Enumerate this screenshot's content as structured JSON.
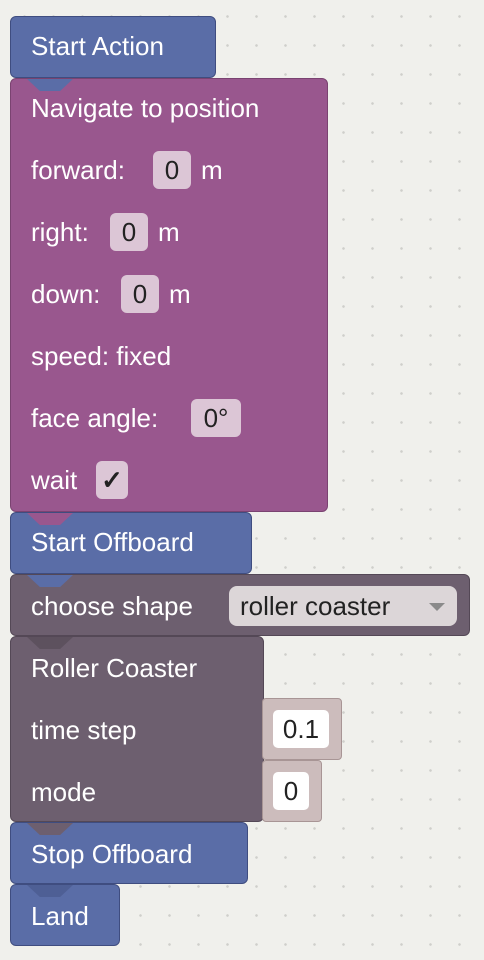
{
  "blocks": {
    "start_action": {
      "label": "Start Action",
      "color": "#5a6da7"
    },
    "navigate": {
      "title": "Navigate to position",
      "color": "#99578e",
      "forward_label": "forward:",
      "forward_value": "0",
      "forward_unit": "m",
      "right_label": "right:",
      "right_value": "0",
      "right_unit": "m",
      "down_label": "down:",
      "down_value": "0",
      "down_unit": "m",
      "speed_label": "speed: fixed",
      "face_angle_label": "face angle:",
      "face_angle_value": "0°",
      "wait_label": "wait",
      "wait_check": "✓",
      "wait_checked": true
    },
    "start_offboard": {
      "label": "Start Offboard",
      "color": "#5a6da7"
    },
    "choose_shape": {
      "label": "choose shape",
      "selected": "roller coaster",
      "color": "#6d5f6f"
    },
    "roller_coaster": {
      "title": "Roller Coaster",
      "time_step_label": "time step",
      "time_step_value": "0.1",
      "mode_label": "mode",
      "mode_value": "0",
      "color": "#6d5f6f"
    },
    "stop_offboard": {
      "label": "Stop Offboard",
      "color": "#5a6da7"
    },
    "land": {
      "label": "Land",
      "color": "#5a6da7"
    }
  }
}
